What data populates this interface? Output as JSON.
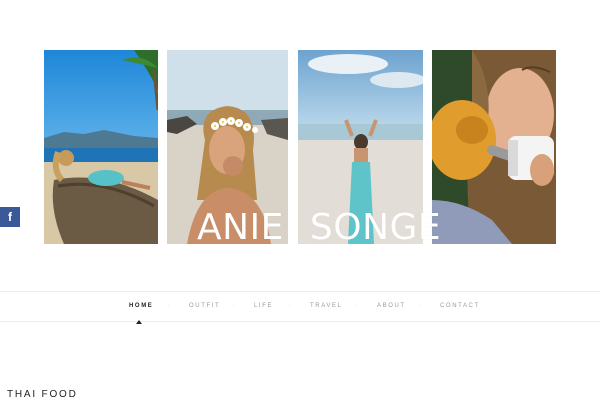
{
  "site": {
    "title_first": "ANIE",
    "title_last": "SONGE"
  },
  "gallery": [
    {
      "subject": "woman reclining on tree trunk at beach"
    },
    {
      "subject": "woman with flower crown"
    },
    {
      "subject": "woman in turquoise dress on beach"
    },
    {
      "subject": "woman feeding baby monkey with bottle"
    }
  ],
  "social": {
    "facebook_glyph": "f",
    "facebook_icon": "facebook-icon",
    "facebook_color": "#3b5998"
  },
  "nav": {
    "items": [
      {
        "label": "HOME",
        "active": true
      },
      {
        "label": "OUTFIT",
        "active": false
      },
      {
        "label": "LIFE",
        "active": false
      },
      {
        "label": "TRAVEL",
        "active": false
      },
      {
        "label": "ABOUT",
        "active": false
      },
      {
        "label": "CONTACT",
        "active": false
      }
    ],
    "separator": "·"
  },
  "post": {
    "title": "THAI FOOD"
  }
}
